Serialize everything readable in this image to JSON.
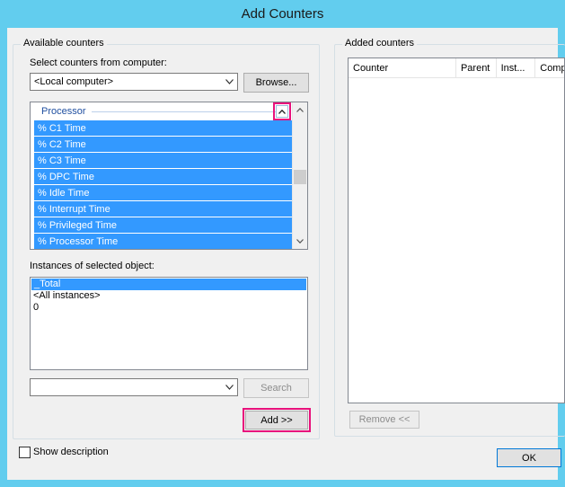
{
  "window": {
    "title": "Add Counters"
  },
  "available": {
    "group_label": "Available counters",
    "select_computer_label": "Select counters from computer:",
    "computer_value": "<Local computer>",
    "browse_label": "Browse...",
    "category": "Processor",
    "counters": [
      "% C1 Time",
      "% C2 Time",
      "% C3 Time",
      "% DPC Time",
      "% Idle Time",
      "% Interrupt Time",
      "% Privileged Time",
      "% Processor Time"
    ],
    "instances_label": "Instances of selected object:",
    "instances": [
      "_Total",
      "<All instances>",
      "0"
    ],
    "search_value": "",
    "search_label": "Search",
    "add_label": "Add >>"
  },
  "added": {
    "group_label": "Added counters",
    "columns": [
      "Counter",
      "Parent",
      "Inst...",
      "Comp"
    ],
    "remove_label": "Remove <<"
  },
  "footer": {
    "show_description_label": "Show description",
    "ok_label": "OK"
  },
  "icons": {
    "combo_arrow": "chevron-down-icon",
    "expand": "chevron-up-icon",
    "scroll_up": "scroll-up-icon",
    "scroll_down": "scroll-down-icon"
  },
  "colors": {
    "title_bar": "#62cdee",
    "selection": "#3399ff",
    "highlight": "#e8127c",
    "category_text": "#1f4fa0"
  }
}
